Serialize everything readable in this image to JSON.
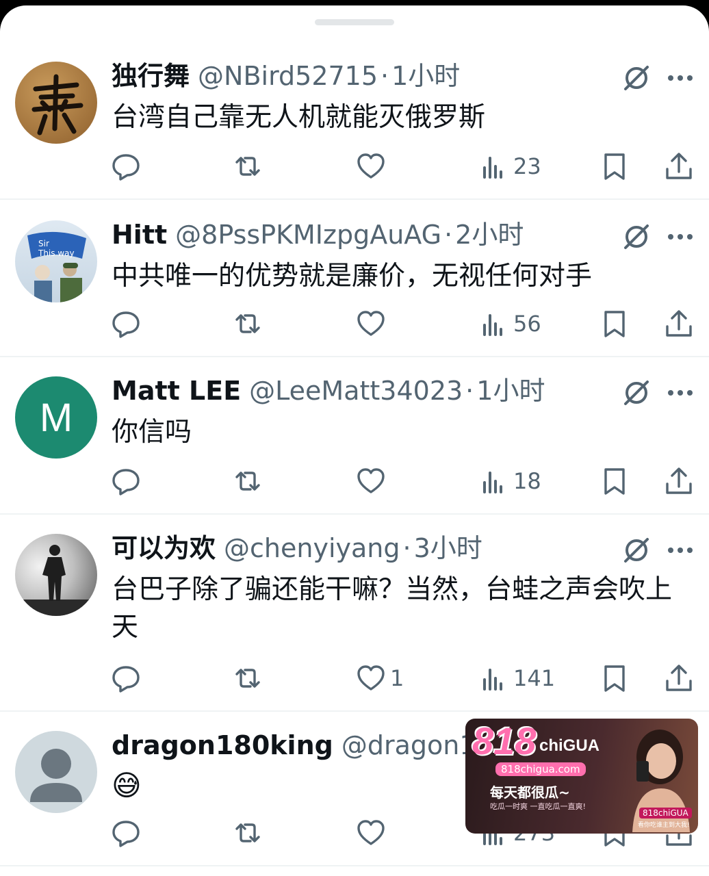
{
  "posts": [
    {
      "display_name": "独行舞",
      "handle": "@NBird52715",
      "sep": "·",
      "time": "1小时",
      "text": "台湾自己靠无人机就能灭俄罗斯",
      "likes": "",
      "views": "23",
      "avatar_letter": ""
    },
    {
      "display_name": "Hitt",
      "handle": "@8PssPKMIzpgAuAG",
      "sep": "·",
      "time": "2小时",
      "text": "中共唯一的优势就是廉价，无视任何对手",
      "likes": "",
      "views": "56",
      "avatar_letter": ""
    },
    {
      "display_name": "Matt LEE",
      "handle": "@LeeMatt34023",
      "sep": "·",
      "time": "1小时",
      "text": "你信吗",
      "likes": "",
      "views": "18",
      "avatar_letter": "M"
    },
    {
      "display_name": "可以为欢",
      "handle": "@chenyiyang",
      "sep": "·",
      "time": "3小时",
      "text": "台巴子除了骗还能干嘛？当然，台蛙之声会吹上天",
      "likes": "1",
      "views": "141",
      "avatar_letter": ""
    },
    {
      "display_name": "dragon180king",
      "handle": "@dragon180",
      "sep": "",
      "time": "",
      "text": "😅",
      "likes": "",
      "views": "273",
      "avatar_letter": ""
    }
  ],
  "watermark": {
    "brand": "818",
    "brand_suffix": "chiGUA",
    "domain": "818chigua.com",
    "slogan": "每天都很瓜~",
    "sub_slogan": "吃瓜一时爽 一直吃瓜一直爽!",
    "badge": "818chiGUA",
    "badge_sub": "看你吃谁主到大我!"
  },
  "colors": {
    "text_primary": "#0f1419",
    "text_secondary": "#536471",
    "divider": "#eff3f4",
    "avatar_green": "#1c8a70",
    "watermark_pink": "#ff6fae"
  },
  "icons": [
    "grok-icon",
    "more-icon",
    "reply-icon",
    "retweet-icon",
    "like-icon",
    "views-icon",
    "bookmark-icon",
    "share-icon"
  ]
}
